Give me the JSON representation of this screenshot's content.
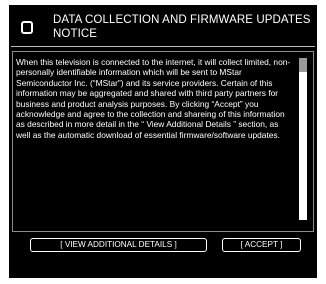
{
  "dialog": {
    "title": "DATA COLLECTION AND FIRMWARE UPDATES NOTICE",
    "body": "When this television is connected to the internet, it will collect limited, non-personally identifiable information which will be sent to MStar Semiconductor Inc. (“MStar”) and its service providers. Certain of this information may be aggregated and shared with third party partners for business and product analysis purposes. By clicking “Accept” you acknowledge and agree to the collection and shareing of this information as described in more detail in the “ View Additional Details ” section, as well as the automatic download of essential firmware/software updates."
  },
  "buttons": {
    "view_details_label": "[ VIEW ADDITIONAL DETAILS ]",
    "accept_label": "[ ACCEPT ]"
  },
  "scrollbar": {
    "position_fraction": 0
  },
  "colors": {
    "background": "#000000",
    "text": "#ffffff",
    "scroll_track": "#ffffff",
    "scroll_thumb": "#9a9a9a"
  }
}
